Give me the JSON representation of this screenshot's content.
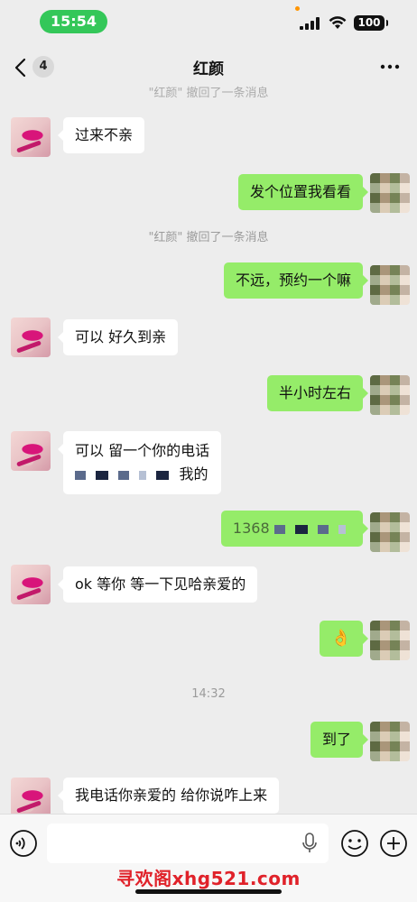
{
  "status_bar": {
    "time": "15:54",
    "battery": "100"
  },
  "nav": {
    "unread_count": "4",
    "title": "红颜"
  },
  "messages": {
    "system_recall_top": "\"红颜\" 撤回了一条消息",
    "m1": "过来不亲",
    "m2": "发个位置我看看",
    "system_recall": "\"红颜\" 撤回了一条消息",
    "m3": "不远，预约一个嘛",
    "m4": "可以 好久到亲",
    "m5": "半小时左右",
    "m6_line1": "可以 留一个你的电话",
    "m6_line2_tail": "我的",
    "m7_prefix": "1368",
    "m8": "ok 等你  等一下见哈亲爱的",
    "m9_emoji": "👌",
    "timestamp": "14:32",
    "m10": "到了",
    "m11": "我电话你亲爱的 给你说咋上来"
  },
  "input": {
    "placeholder": ""
  },
  "watermark": "寻欢阁xhg521.com",
  "colors": {
    "bubble_sent": "#95ec69",
    "bubble_received": "#ffffff",
    "background": "#ededed",
    "time_pill": "#34c759"
  },
  "icons": [
    "back-icon",
    "more-icon",
    "signal-icon",
    "wifi-icon",
    "voice-icon",
    "mic-icon",
    "emoji-icon",
    "plus-icon"
  ]
}
